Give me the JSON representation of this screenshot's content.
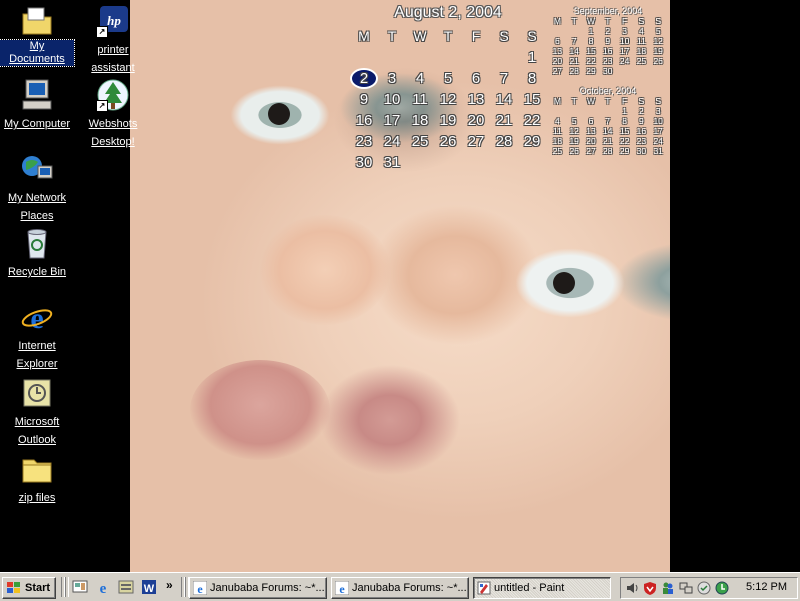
{
  "desktop_icons": [
    {
      "label_l1": "My Documents",
      "label_l2": ""
    },
    {
      "label_l1": "printer",
      "label_l2": "assistant"
    },
    {
      "label_l1": "My Computer",
      "label_l2": ""
    },
    {
      "label_l1": "Webshots",
      "label_l2": "Desktop!"
    },
    {
      "label_l1": "My Network",
      "label_l2": "Places"
    },
    {
      "label_l1": "Recycle Bin",
      "label_l2": ""
    },
    {
      "label_l1": "Internet",
      "label_l2": "Explorer"
    },
    {
      "label_l1": "Microsoft",
      "label_l2": "Outlook"
    },
    {
      "label_l1": "zip files",
      "label_l2": ""
    }
  ],
  "calendar": {
    "title": "August 2, 2004",
    "weekdays": [
      "M",
      "T",
      "W",
      "T",
      "F",
      "S",
      "S"
    ],
    "today": "2",
    "days": [
      "",
      "",
      "",
      "",
      "",
      "",
      "1",
      "2",
      "3",
      "4",
      "5",
      "6",
      "7",
      "8",
      "9",
      "10",
      "11",
      "12",
      "13",
      "14",
      "15",
      "16",
      "17",
      "18",
      "19",
      "20",
      "21",
      "22",
      "23",
      "24",
      "25",
      "26",
      "27",
      "28",
      "29",
      "30",
      "31"
    ],
    "september": {
      "title": "September, 2004",
      "weekdays": [
        "M",
        "T",
        "W",
        "T",
        "F",
        "S",
        "S"
      ],
      "days": [
        "",
        "",
        "1",
        "2",
        "3",
        "4",
        "5",
        "6",
        "7",
        "8",
        "9",
        "10",
        "11",
        "12",
        "13",
        "14",
        "15",
        "16",
        "17",
        "18",
        "19",
        "20",
        "21",
        "22",
        "23",
        "24",
        "25",
        "26",
        "27",
        "28",
        "29",
        "30"
      ]
    },
    "october": {
      "title": "October, 2004",
      "weekdays": [
        "M",
        "T",
        "W",
        "T",
        "F",
        "S",
        "S"
      ],
      "days": [
        "",
        "",
        "",
        "",
        "1",
        "2",
        "3",
        "4",
        "5",
        "6",
        "7",
        "8",
        "9",
        "10",
        "11",
        "12",
        "13",
        "14",
        "15",
        "16",
        "17",
        "18",
        "19",
        "20",
        "21",
        "22",
        "23",
        "24",
        "25",
        "26",
        "27",
        "28",
        "29",
        "30",
        "31"
      ]
    }
  },
  "taskbar": {
    "start_label": "Start",
    "quicklaunch_more": "»",
    "tasks": [
      {
        "label": "Janubaba Forums: ~*...",
        "active": false
      },
      {
        "label": "Janubaba Forums: ~*...",
        "active": false
      },
      {
        "label": "untitled - Paint",
        "active": true
      }
    ],
    "clock": "5:12 PM"
  },
  "colors": {
    "desktop_bg": "#000000",
    "taskbar": "#d4d0c8",
    "selection": "#0a246a"
  }
}
